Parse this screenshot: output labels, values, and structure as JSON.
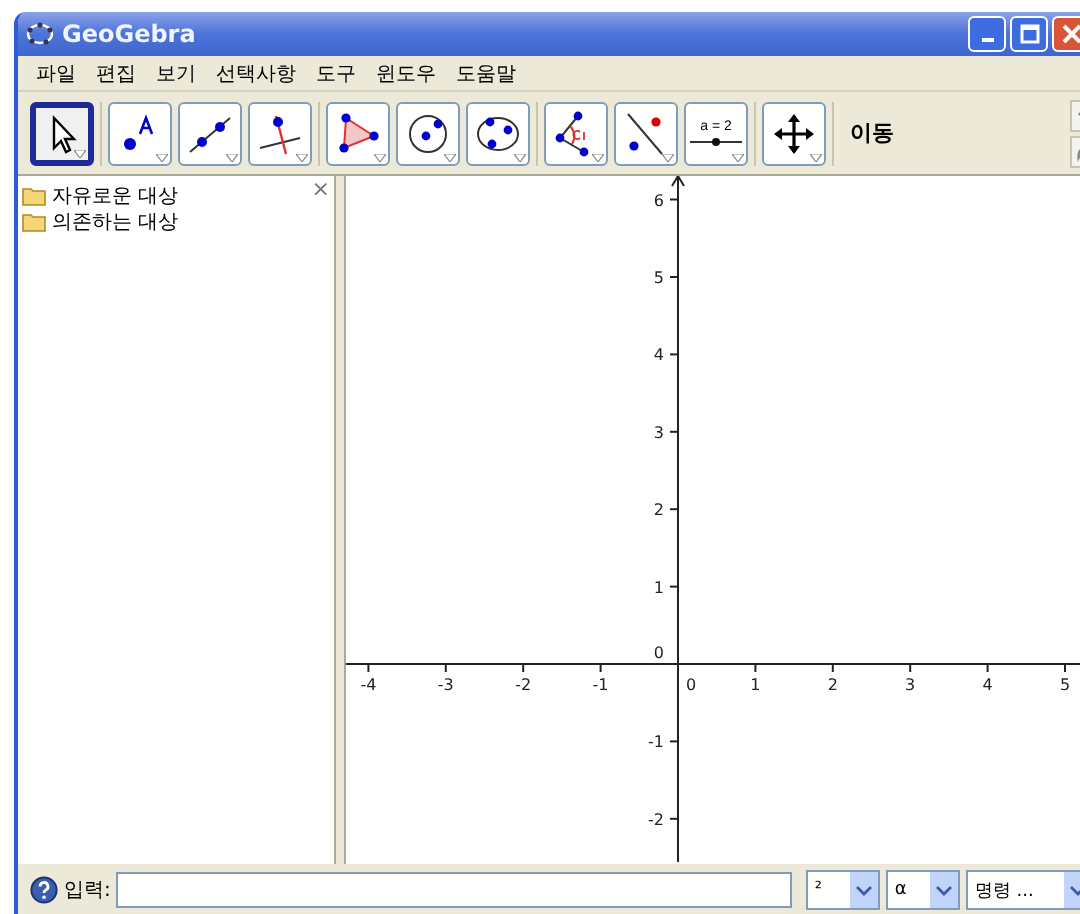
{
  "window": {
    "title": "GeoGebra"
  },
  "menu": [
    "파일",
    "편집",
    "보기",
    "선택사항",
    "도구",
    "윈도우",
    "도움말"
  ],
  "toolbar": {
    "groups": [
      [
        {
          "kind": "move",
          "selected": true
        }
      ],
      [
        {
          "kind": "point",
          "selected": false
        },
        {
          "kind": "line",
          "selected": false
        },
        {
          "kind": "perpendicular",
          "selected": false
        }
      ],
      [
        {
          "kind": "polygon",
          "selected": false
        },
        {
          "kind": "circle",
          "selected": false
        },
        {
          "kind": "conic",
          "selected": false
        }
      ],
      [
        {
          "kind": "angle",
          "selected": false
        },
        {
          "kind": "reflect",
          "selected": false
        },
        {
          "kind": "slider",
          "selected": false,
          "label": "a = 2"
        }
      ],
      [
        {
          "kind": "move-view",
          "selected": false
        }
      ]
    ],
    "tool_name": "이동"
  },
  "algebra": {
    "close": "×",
    "items": [
      "자유로운 대상",
      "의존하는 대상"
    ]
  },
  "graphics": {
    "x_ticks": [
      "-4",
      "-3",
      "-2",
      "-1",
      "0",
      "1",
      "2",
      "3",
      "4",
      "5"
    ],
    "y_ticks": [
      "6",
      "5",
      "4",
      "3",
      "2",
      "1",
      "0",
      "-1",
      "-2"
    ]
  },
  "input_bar": {
    "label": "입력:",
    "selects": [
      "²",
      "α",
      "명령 ..."
    ]
  }
}
